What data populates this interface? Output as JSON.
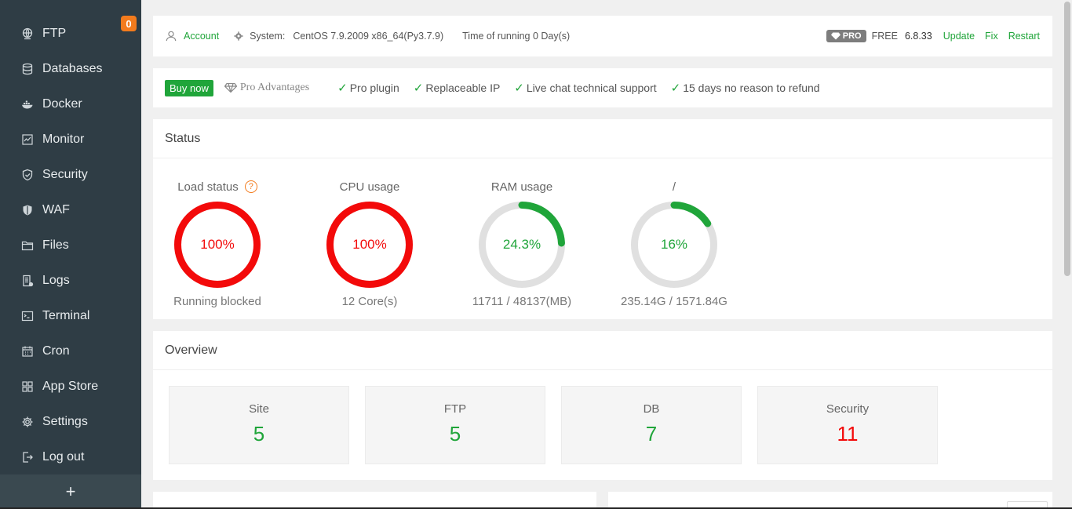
{
  "sidebar": {
    "ftp_badge": "0",
    "items": [
      {
        "label": "FTP",
        "icon": "globe-icon"
      },
      {
        "label": "Databases",
        "icon": "database-icon"
      },
      {
        "label": "Docker",
        "icon": "docker-icon"
      },
      {
        "label": "Monitor",
        "icon": "monitor-icon"
      },
      {
        "label": "Security",
        "icon": "shield-icon"
      },
      {
        "label": "WAF",
        "icon": "waf-shield-icon"
      },
      {
        "label": "Files",
        "icon": "folder-icon"
      },
      {
        "label": "Logs",
        "icon": "log-icon"
      },
      {
        "label": "Terminal",
        "icon": "terminal-icon"
      },
      {
        "label": "Cron",
        "icon": "calendar-icon"
      },
      {
        "label": "App Store",
        "icon": "grid-icon"
      },
      {
        "label": "Settings",
        "icon": "gear-icon"
      },
      {
        "label": "Log out",
        "icon": "logout-icon"
      }
    ],
    "add_label": "+"
  },
  "topbar": {
    "account": "Account",
    "system_label": "System:",
    "system_value": "CentOS 7.9.2009 x86_64(Py3.7.9)",
    "running": "Time of running 0 Day(s)",
    "pro_tag": "PRO",
    "free": "FREE",
    "version": "6.8.33",
    "update": "Update",
    "fix": "Fix",
    "restart": "Restart"
  },
  "probar": {
    "buy": "Buy now",
    "pro_adv": "Pro Advantages",
    "features": [
      "Pro plugin",
      "Replaceable IP",
      "Live chat technical support",
      "15 days no reason to refund"
    ]
  },
  "status": {
    "title": "Status",
    "gauges": [
      {
        "title": "Load status",
        "value": "100%",
        "percent": 100,
        "sub": "Running blocked",
        "color": "#f30a0a",
        "help": "?"
      },
      {
        "title": "CPU usage",
        "value": "100%",
        "percent": 100,
        "sub": "12 Core(s)",
        "color": "#f30a0a"
      },
      {
        "title": "RAM usage",
        "value": "24.3%",
        "percent": 24.3,
        "sub": "11711 / 48137(MB)",
        "color": "#20a53a"
      },
      {
        "title": "/",
        "value": "16%",
        "percent": 16,
        "sub": "235.14G / 1571.84G",
        "color": "#20a53a"
      }
    ]
  },
  "overview": {
    "title": "Overview",
    "cards": [
      {
        "label": "Site",
        "value": "5",
        "color": "#20a53a"
      },
      {
        "label": "FTP",
        "value": "5",
        "color": "#20a53a"
      },
      {
        "label": "DB",
        "value": "7",
        "color": "#20a53a"
      },
      {
        "label": "Security",
        "value": "11",
        "color": "#f30a0a"
      }
    ]
  },
  "colors": {
    "accent": "#20a53a",
    "danger": "#f30a0a",
    "sidebar": "#2f3d45",
    "badge": "#f37b1d"
  }
}
